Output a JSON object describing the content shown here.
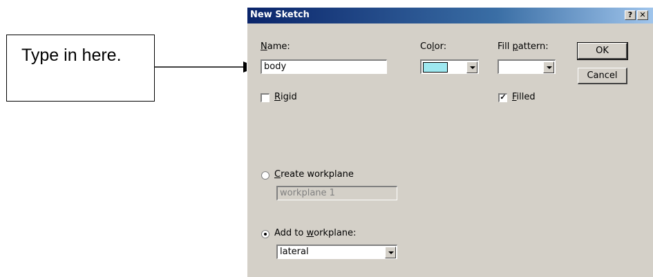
{
  "callout": {
    "text": "Type in here."
  },
  "dialog": {
    "title": "New Sketch",
    "help_glyph": "?",
    "close_glyph": "✕",
    "name": {
      "label_prefix": "",
      "label_access": "N",
      "label_rest": "ame:",
      "value": "body"
    },
    "color": {
      "label_pre": "Co",
      "label_access": "l",
      "label_rest": "or:",
      "swatch": "#9ee8f0"
    },
    "fill_pattern": {
      "label_pre": "Fill ",
      "label_access": "p",
      "label_rest": "attern:",
      "value": ""
    },
    "rigid": {
      "label_access": "R",
      "label_rest": "igid",
      "checked": false
    },
    "filled": {
      "label_access": "F",
      "label_rest": "illed",
      "checked": true,
      "mark": "✓"
    },
    "create_workplane": {
      "label_access": "C",
      "label_rest": "reate workplane",
      "selected": false,
      "value": "workplane 1"
    },
    "add_to_workplane": {
      "label_pre": "Add to ",
      "label_access": "w",
      "label_rest": "orkplane:",
      "selected": true,
      "value": "lateral"
    },
    "ok_label": "OK",
    "cancel_label": "Cancel"
  }
}
